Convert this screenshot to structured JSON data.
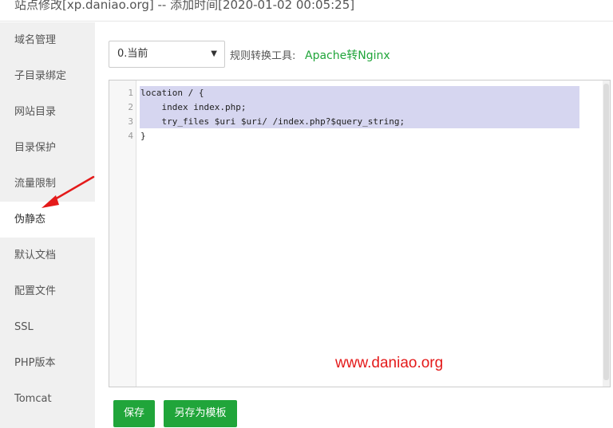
{
  "window": {
    "title": "站点修改[xp.daniao.org] -- 添加时间[2020-01-02 00:05:25]"
  },
  "sidebar": {
    "items": [
      {
        "label": "域名管理"
      },
      {
        "label": "子目录绑定"
      },
      {
        "label": "网站目录"
      },
      {
        "label": "目录保护"
      },
      {
        "label": "流量限制"
      },
      {
        "label": "伪静态",
        "active": true
      },
      {
        "label": "默认文档"
      },
      {
        "label": "配置文件"
      },
      {
        "label": "SSL"
      },
      {
        "label": "PHP版本"
      },
      {
        "label": "Tomcat"
      }
    ]
  },
  "toolbar": {
    "select_value": "0.当前",
    "tool_label": "规则转换工具:",
    "tool_link": "Apache转Nginx"
  },
  "editor": {
    "line_numbers": [
      "1",
      "2",
      "3",
      "4"
    ],
    "lines": [
      "location / {",
      "    index index.php;",
      "    try_files $uri $uri/ /index.php?$query_string;",
      "}"
    ]
  },
  "watermark": "www.daniao.org",
  "buttons": {
    "save": "保存",
    "save_as_template": "另存为模板"
  },
  "colors": {
    "accent": "#20a53a",
    "watermark": "#e41a1a",
    "annotation_arrow": "#e41a1a",
    "selection": "#d6d6f0"
  }
}
